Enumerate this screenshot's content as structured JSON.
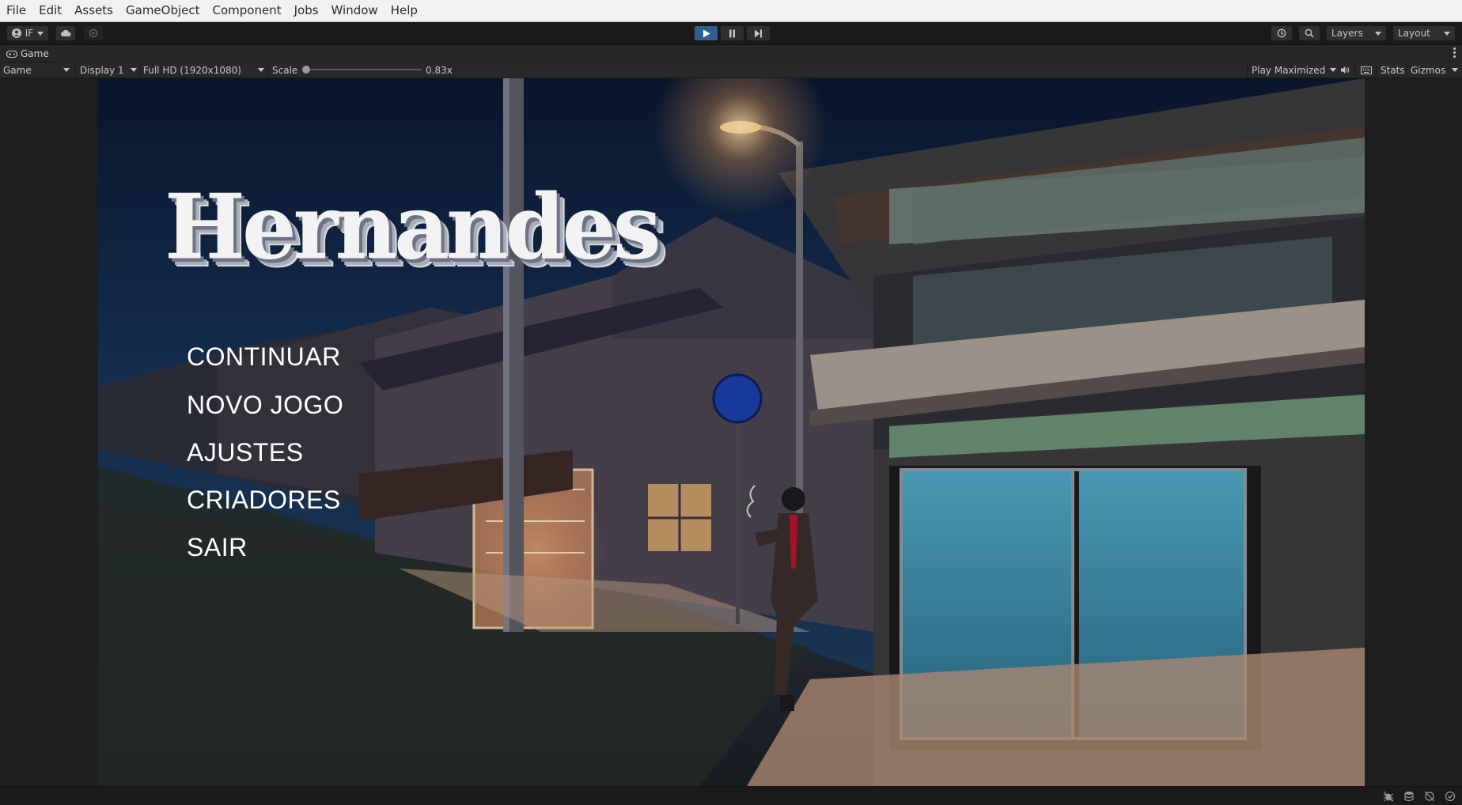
{
  "menubar": {
    "items": [
      "File",
      "Edit",
      "Assets",
      "GameObject",
      "Component",
      "Jobs",
      "Window",
      "Help"
    ]
  },
  "toolbar": {
    "account_label": "IF",
    "account_icon": "account-icon",
    "cloud_icon": "cloud-icon",
    "collab_icon": "collab-icon",
    "play_icon": "play-icon",
    "pause_icon": "pause-icon",
    "step_icon": "step-icon",
    "history_icon": "history-icon",
    "search_icon": "search-icon",
    "layers_label": "Layers",
    "layout_label": "Layout",
    "play_active_color": "#2f5f92"
  },
  "tab": {
    "label": "Game",
    "icon": "gamepad-icon"
  },
  "game_toolbar": {
    "mode": "Game",
    "display": "Display 1",
    "resolution": "Full HD (1920x1080)",
    "scale_label": "Scale",
    "scale_value": "0.83x",
    "scale_fraction": 0.0,
    "play_mode": "Play Maximized",
    "audio_icon": "speaker-icon",
    "keyboard_icon": "keyboard-icon",
    "stats_label": "Stats",
    "gizmos_label": "Gizmos"
  },
  "game": {
    "title": "Hernandes",
    "menu": [
      "CONTINUAR",
      "NOVO JOGO",
      "AJUSTES",
      "CRIADORES",
      "SAIR"
    ]
  },
  "statusbar": {
    "icons": [
      "bug-icon",
      "database-icon",
      "cache-icon",
      "progress-icon"
    ]
  }
}
